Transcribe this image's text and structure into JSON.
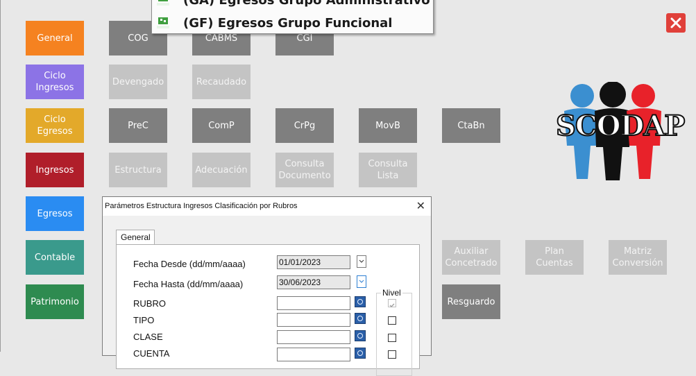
{
  "dropdown_menu": {
    "items": [
      {
        "label": "(GA) Egresos Grupo Administrativo"
      },
      {
        "label": "(GF) Egresos Grupo Funcional"
      }
    ]
  },
  "sidebar": {
    "items": [
      {
        "label": "General",
        "color": "#f58220"
      },
      {
        "label": "Ciclo\nIngresos",
        "color": "#8c73e6"
      },
      {
        "label": "Ciclo\nEgresos",
        "color": "#e3a92a"
      },
      {
        "label": "Ingresos",
        "color": "#b01e2a"
      },
      {
        "label": "Egresos",
        "color": "#2a8cf2"
      },
      {
        "label": "Contable",
        "color": "#3a9a8c"
      },
      {
        "label": "Patrimonio",
        "color": "#2e8b50"
      }
    ]
  },
  "row1": [
    "COG",
    "CABMS",
    "CGI"
  ],
  "row2": [
    "Devengado",
    "Recaudado"
  ],
  "row3": [
    "PreC",
    "ComP",
    "CrPg",
    "MovB",
    "CtaBn"
  ],
  "row4": [
    "Estructura",
    "Adecuación",
    "Consulta\nDocumento",
    "Consulta\nLista"
  ],
  "row6": [
    "Auxiliar\nConcetrado",
    "Plan\nCuentas",
    "Matriz\nConversión"
  ],
  "row7": [
    "Resguardo"
  ],
  "logo": {
    "text": "SCODAP",
    "colors": [
      "#3b8fd0",
      "#111111",
      "#e8222a"
    ]
  },
  "dialog": {
    "title": "Parámetros Estructura Ingresos Clasificación por Rubros",
    "tab": "General",
    "fecha_desde_label": "Fecha Desde (dd/mm/aaaa)",
    "fecha_desde_value": "01/01/2023",
    "fecha_hasta_label": "Fecha Hasta (dd/mm/aaaa)",
    "fecha_hasta_value": "30/06/2023",
    "nivel_label": "Nivel",
    "fields": [
      "RUBRO",
      "TIPO",
      "CLASE",
      "CUENTA"
    ],
    "nivel_checked": [
      true,
      false,
      false,
      false
    ]
  }
}
